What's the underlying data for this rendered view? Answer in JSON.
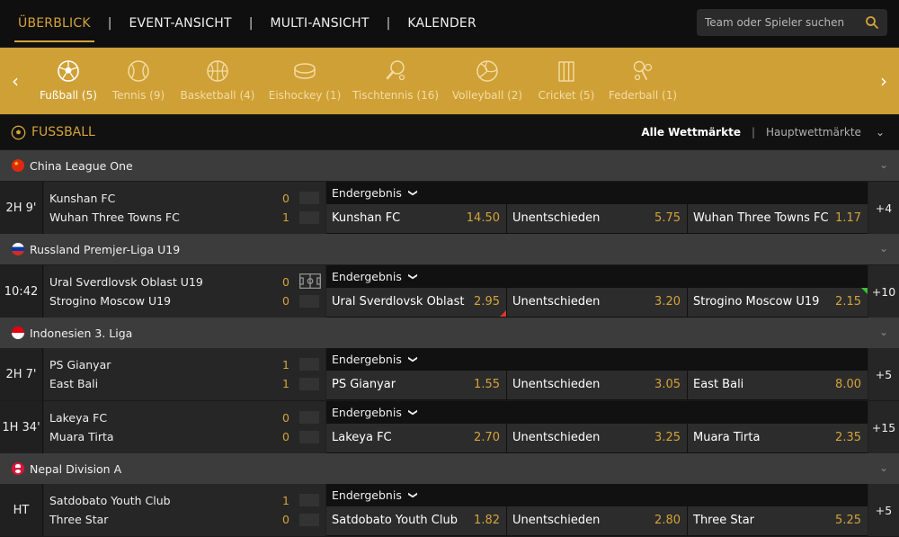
{
  "nav": {
    "tabs": [
      "ÜBERBLICK",
      "EVENT-ANSICHT",
      "MULTI-ANSICHT",
      "KALENDER"
    ],
    "active_tab": "ÜBERBLICK",
    "search_placeholder": "Team oder Spieler suchen"
  },
  "sports": [
    {
      "label": "Fußball (5)",
      "icon": "soccer-ball-icon"
    },
    {
      "label": "Tennis (9)",
      "icon": "tennis-ball-icon"
    },
    {
      "label": "Basketball (4)",
      "icon": "basketball-icon"
    },
    {
      "label": "Eishockey (1)",
      "icon": "hockey-puck-icon"
    },
    {
      "label": "Tischtennis (16)",
      "icon": "table-tennis-icon"
    },
    {
      "label": "Volleyball (2)",
      "icon": "volleyball-icon"
    },
    {
      "label": "Cricket (5)",
      "icon": "cricket-icon"
    },
    {
      "label": "Federball (1)",
      "icon": "badminton-icon"
    }
  ],
  "section": {
    "title": "FUSSBALL",
    "markets_all": "Alle Wettmärkte",
    "markets_main": "Hauptwettmärkte"
  },
  "leagues": [
    {
      "name": "China League One",
      "flag": "china"
    },
    {
      "name": "Russland Premjer-Liga U19",
      "flag": "russia"
    },
    {
      "name": "Indonesien 3. Liga",
      "flag": "indonesia"
    },
    {
      "name": "Nepal Division A",
      "flag": "nepal"
    }
  ],
  "matches": [
    {
      "time": "2H 9'",
      "home": "Kunshan FC",
      "away": "Wuhan Three Towns FC",
      "score_home": "0",
      "score_away": "1",
      "market": "Endergebnis",
      "odds": [
        {
          "name": "Kunshan FC",
          "value": "14.50"
        },
        {
          "name": "Unentschieden",
          "value": "5.75"
        },
        {
          "name": "Wuhan Three Towns FC",
          "value": "1.17"
        }
      ],
      "more": "+4"
    },
    {
      "time": "10:42",
      "home": "Ural Sverdlovsk Oblast U19",
      "away": "Strogino Moscow U19",
      "score_home": "0",
      "score_away": "0",
      "market": "Endergebnis",
      "odds": [
        {
          "name": "Ural Sverdlovsk Oblast ...",
          "value": "2.95",
          "trend": "down"
        },
        {
          "name": "Unentschieden",
          "value": "3.20"
        },
        {
          "name": "Strogino Moscow U19",
          "value": "2.15",
          "trend": "up"
        }
      ],
      "more": "+10"
    },
    {
      "time": "2H 7'",
      "home": "PS Gianyar",
      "away": "East Bali",
      "score_home": "1",
      "score_away": "1",
      "market": "Endergebnis",
      "odds": [
        {
          "name": "PS Gianyar",
          "value": "1.55"
        },
        {
          "name": "Unentschieden",
          "value": "3.05"
        },
        {
          "name": "East Bali",
          "value": "8.00"
        }
      ],
      "more": "+5"
    },
    {
      "time": "1H 34'",
      "home": "Lakeya FC",
      "away": "Muara Tirta",
      "score_home": "0",
      "score_away": "0",
      "market": "Endergebnis",
      "odds": [
        {
          "name": "Lakeya FC",
          "value": "2.70"
        },
        {
          "name": "Unentschieden",
          "value": "3.25"
        },
        {
          "name": "Muara Tirta",
          "value": "2.35"
        }
      ],
      "more": "+15"
    },
    {
      "time": "HT",
      "home": "Satdobato Youth Club",
      "away": "Three Star",
      "score_home": "1",
      "score_away": "0",
      "market": "Endergebnis",
      "odds": [
        {
          "name": "Satdobato Youth Club",
          "value": "1.82"
        },
        {
          "name": "Unentschieden",
          "value": "2.80"
        },
        {
          "name": "Three Star",
          "value": "5.25"
        }
      ],
      "more": "+5"
    }
  ],
  "colors": {
    "accent": "#d4a33a",
    "sportsbar": "#cfa035",
    "odd_down": "#e0352b",
    "odd_up": "#3bc13b"
  }
}
